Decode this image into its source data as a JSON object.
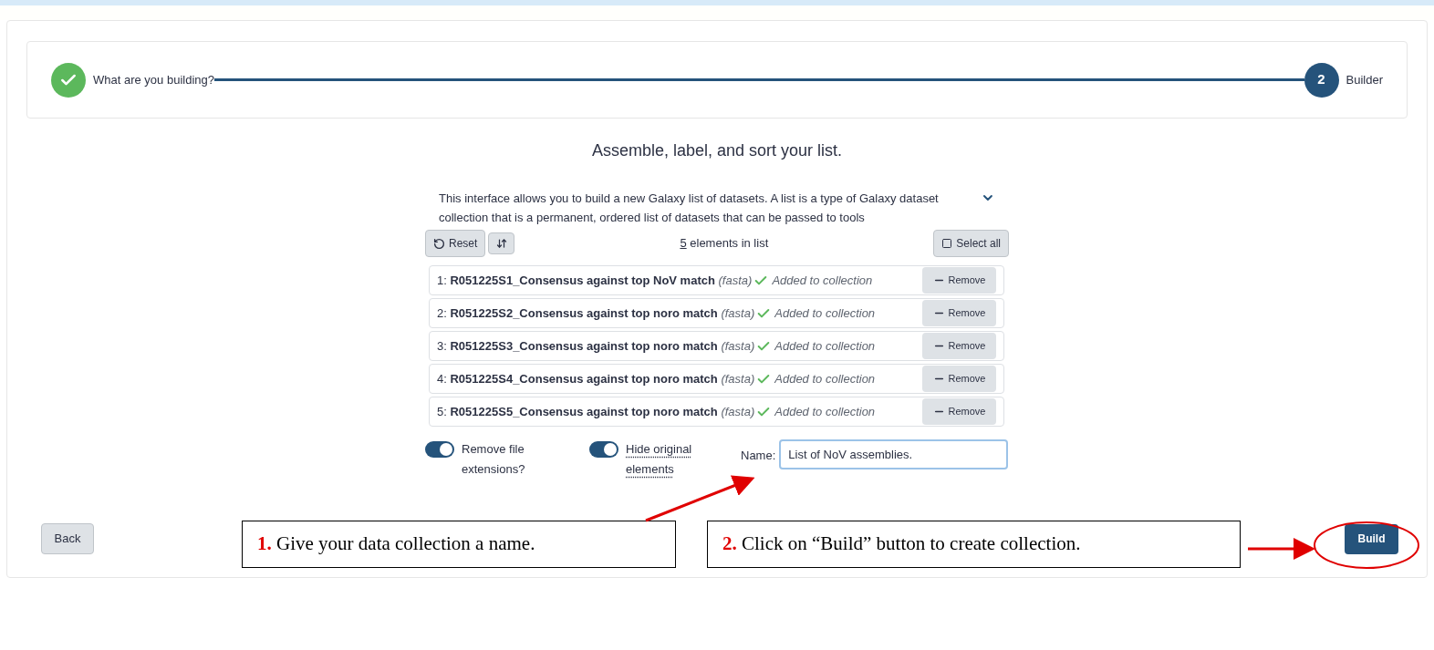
{
  "stepper": {
    "steps": [
      {
        "label": "What are you building?",
        "kind": "done"
      },
      {
        "label": "Builder",
        "kind": "current",
        "number": "2"
      }
    ]
  },
  "heading": "Assemble, label, and sort your list.",
  "description": {
    "text": "This interface allows you to build a new Galaxy list of datasets. A list is a type of Galaxy dataset collection that is a permanent, ordered list of datasets that can be passed to tools",
    "expanded": false
  },
  "toolbar": {
    "reset": "Reset",
    "count": "5",
    "count_label": "elements in list",
    "select_all": "Select all"
  },
  "elements": [
    {
      "index": "1:",
      "name": "R051225S1_Consensus against top NoV match",
      "extension": "(fasta)",
      "status": "Added to collection",
      "button": "Remove"
    },
    {
      "index": "2:",
      "name": "R051225S2_Consensus against top noro match",
      "extension": "(fasta)",
      "status": "Added to collection",
      "button": "Remove"
    },
    {
      "index": "3:",
      "name": "R051225S3_Consensus against top noro match",
      "extension": "(fasta)",
      "status": "Added to collection",
      "button": "Remove"
    },
    {
      "index": "4:",
      "name": "R051225S4_Consensus against top noro match",
      "extension": "(fasta)",
      "status": "Added to collection",
      "button": "Remove"
    },
    {
      "index": "5:",
      "name": "R051225S5_Consensus against top noro match",
      "extension": "(fasta)",
      "status": "Added to collection",
      "button": "Remove"
    }
  ],
  "options": [
    {
      "label": "Remove file extensions?",
      "on": true,
      "dotted": false
    },
    {
      "label": "Hide original elements",
      "on": true,
      "dotted": true
    }
  ],
  "name_field": {
    "label": "Name:",
    "value": "List of NoV assemblies."
  },
  "footer": {
    "back": "Back",
    "build": "Build"
  },
  "annotations": [
    {
      "number": "1.",
      "text": "Give your data collection a name."
    },
    {
      "number": "2.",
      "text": "Click on “Build” button to create collection."
    }
  ]
}
